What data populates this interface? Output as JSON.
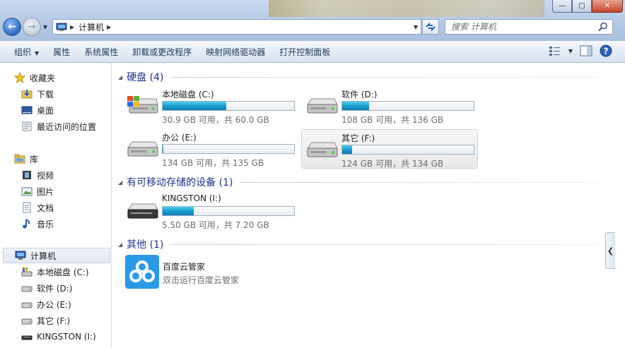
{
  "window": {
    "minimize": "—",
    "maximize": "▢",
    "close": "✕"
  },
  "address": {
    "crumb": "计算机"
  },
  "search": {
    "placeholder": "搜索 计算机"
  },
  "toolbar": {
    "organize": "组织",
    "properties": "属性",
    "system_properties": "系统属性",
    "uninstall": "卸载或更改程序",
    "map_drive": "映射网络驱动器",
    "control_panel": "打开控制面板"
  },
  "sidebar": {
    "favorites": "收藏夹",
    "downloads": "下载",
    "desktop": "桌面",
    "recent": "最近访问的位置",
    "libraries": "库",
    "videos": "视频",
    "pictures": "图片",
    "documents": "文档",
    "music": "音乐",
    "computer": "计算机",
    "drive_c": "本地磁盘 (C:)",
    "drive_d": "软件 (D:)",
    "drive_e": "办公 (E:)",
    "drive_f": "其它 (F:)",
    "drive_i": "KINGSTON (I:)"
  },
  "groups": {
    "hard_disks": "硬盘 (4)",
    "removable": "有可移动存储的设备 (1)",
    "other": "其他 (1)"
  },
  "drives": [
    {
      "name": "本地磁盘 (C:)",
      "info": "30.9 GB 可用，共 60.0 GB",
      "used_fraction": 0.485
    },
    {
      "name": "软件 (D:)",
      "info": "108 GB 可用，共 136 GB",
      "used_fraction": 0.206
    },
    {
      "name": "办公 (E:)",
      "info": "134 GB 可用，共 135 GB",
      "used_fraction": 0.007
    },
    {
      "name": "其它 (F:)",
      "info": "124 GB 可用，共 134 GB",
      "used_fraction": 0.075
    },
    {
      "name": "KINGSTON (I:)",
      "info": "5.50 GB 可用，共 7.20 GB",
      "used_fraction": 0.236
    }
  ],
  "app": {
    "name": "百度云管家",
    "desc": "双击运行百度云管家"
  },
  "colors": {
    "fill": "#1c9ccf",
    "group_header": "#1e3287"
  }
}
